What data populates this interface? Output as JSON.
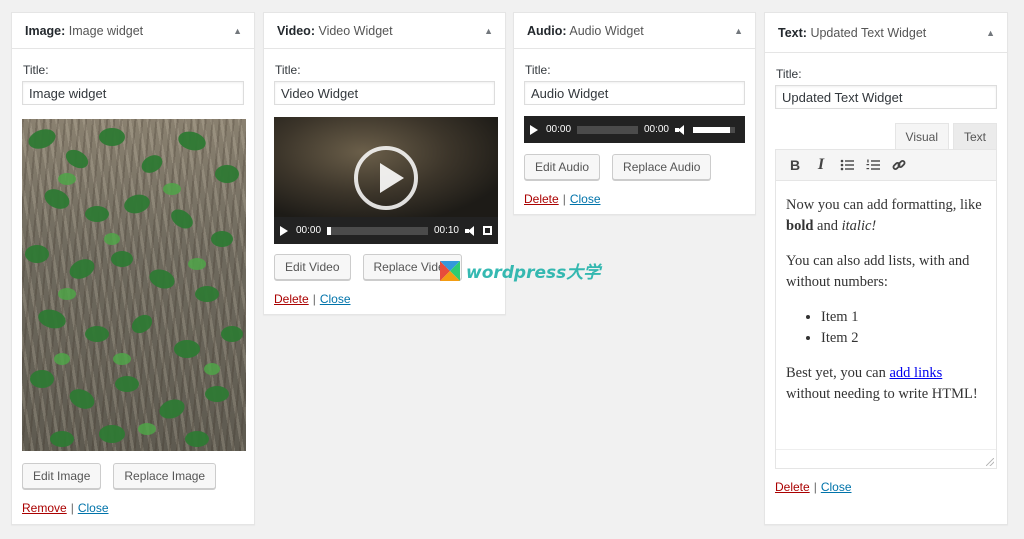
{
  "image_widget": {
    "type": "Image",
    "name": "Image widget",
    "title_label": "Title:",
    "title_value": "Image widget",
    "edit_label": "Edit Image",
    "replace_label": "Replace Image",
    "remove_label": "Remove",
    "close_label": "Close"
  },
  "video_widget": {
    "type": "Video",
    "name": "Video Widget",
    "title_label": "Title:",
    "title_value": "Video Widget",
    "current_time": "00:00",
    "duration": "00:10",
    "edit_label": "Edit Video",
    "replace_label": "Replace Video",
    "delete_label": "Delete",
    "close_label": "Close"
  },
  "audio_widget": {
    "type": "Audio",
    "name": "Audio Widget",
    "title_label": "Title:",
    "title_value": "Audio Widget",
    "current_time": "00:00",
    "duration": "00:00",
    "edit_label": "Edit Audio",
    "replace_label": "Replace Audio",
    "delete_label": "Delete",
    "close_label": "Close"
  },
  "text_widget": {
    "type": "Text",
    "name": "Updated Text Widget",
    "title_label": "Title:",
    "title_value": "Updated Text Widget",
    "tab_visual": "Visual",
    "tab_text": "Text",
    "content": {
      "p1_a": "Now you can add formatting, like ",
      "p1_bold": "bold",
      "p1_b": " and ",
      "p1_italic": "italic!",
      "p2": "You can also add lists, with and without numbers:",
      "items": [
        "Item 1",
        "Item 2"
      ],
      "p3_a": "Best yet, you can ",
      "p3_link": "add links",
      "p3_b": " without needing to write HTML!"
    },
    "delete_label": "Delete",
    "close_label": "Close"
  },
  "separator": "|",
  "toggle_glyph": "▲",
  "watermark": "wordpress大学",
  "colors": {
    "delete_red": "#a00",
    "close_blue": "#0073aa",
    "watermark_teal": "#20b2aa"
  }
}
